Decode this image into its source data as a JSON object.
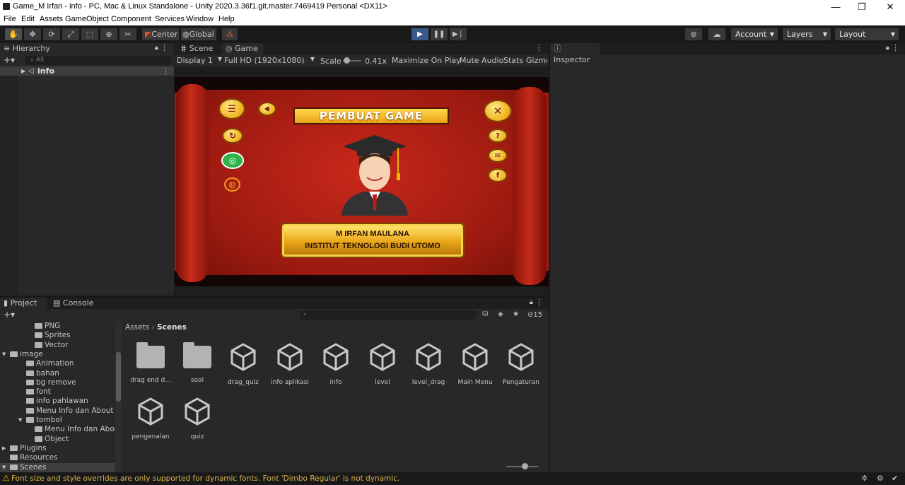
{
  "window": {
    "title": "Game_M Irfan - info - PC, Mac & Linux Standalone - Unity 2020.3.36f1.git.master.7469419 Personal <DX11>",
    "minimize": "—",
    "maximize": "❐",
    "close": "✕"
  },
  "menubar": [
    "File",
    "Edit",
    "Assets",
    "GameObject",
    "Component",
    "Services",
    "Window",
    "Help"
  ],
  "toolbar": {
    "pivot_label": "Center",
    "space_label": "Global",
    "account_label": "Account",
    "layers_label": "Layers",
    "layout_label": "Layout"
  },
  "hierarchy": {
    "tab": "Hierarchy",
    "search_placeholder": "All",
    "root_item": "info"
  },
  "scene_tabs": {
    "scene": "Scene",
    "game": "Game"
  },
  "game_bar": {
    "display": "Display 1",
    "resolution": "Full HD (1920x1080)",
    "scale_label": "Scale",
    "scale_value": "0.41x",
    "maximize": "Maximize On Play",
    "mute": "Mute Audio",
    "stats": "Stats",
    "gizmos": "Gizmo"
  },
  "game_view": {
    "banner_title": "PEMBUAT GAME",
    "name": "M IRFAN MAULANA",
    "institution": "INSTITUT TEKNOLOGI BUDI UTOMO",
    "accent_red": "#b01c10",
    "gold": "#f2b21e"
  },
  "inspector": {
    "tab": "Inspector"
  },
  "project": {
    "tab_project": "Project",
    "tab_console": "Console",
    "hidden_count": "15",
    "breadcrumb_root": "Assets",
    "breadcrumb_current": "Scenes",
    "tree": [
      {
        "label": "PNG",
        "indent": 3
      },
      {
        "label": "Sprites",
        "indent": 3
      },
      {
        "label": "Vector",
        "indent": 3
      },
      {
        "label": "image",
        "indent": 1,
        "expanded": true
      },
      {
        "label": "Animation",
        "indent": 2
      },
      {
        "label": "bahan",
        "indent": 2
      },
      {
        "label": "bg remove",
        "indent": 2
      },
      {
        "label": "font",
        "indent": 2
      },
      {
        "label": "info pahlawan",
        "indent": 2
      },
      {
        "label": "Menu Info dan About",
        "indent": 2
      },
      {
        "label": "tombol",
        "indent": 2,
        "expanded": true
      },
      {
        "label": "Menu Info dan About",
        "indent": 3
      },
      {
        "label": "Object",
        "indent": 3
      },
      {
        "label": "Plugins",
        "indent": 1,
        "collapsed": true
      },
      {
        "label": "Resources",
        "indent": 1
      },
      {
        "label": "Scenes",
        "indent": 1,
        "expanded": true,
        "selected": true
      }
    ],
    "assets": [
      {
        "label": "drag end d...",
        "kind": "folder"
      },
      {
        "label": "soal",
        "kind": "folder"
      },
      {
        "label": "drag_quiz",
        "kind": "scene"
      },
      {
        "label": "info aplikasi",
        "kind": "scene"
      },
      {
        "label": "info",
        "kind": "scene"
      },
      {
        "label": "level",
        "kind": "scene"
      },
      {
        "label": "level_drag",
        "kind": "scene"
      },
      {
        "label": "Main Menu",
        "kind": "scene"
      },
      {
        "label": "Pengaturan",
        "kind": "scene"
      },
      {
        "label": "pengenalan",
        "kind": "scene"
      },
      {
        "label": "quiz",
        "kind": "scene"
      }
    ]
  },
  "status": {
    "message": "Font size and style overrides are only supported for dynamic fonts. Font 'Dimbo Regular' is not dynamic."
  }
}
